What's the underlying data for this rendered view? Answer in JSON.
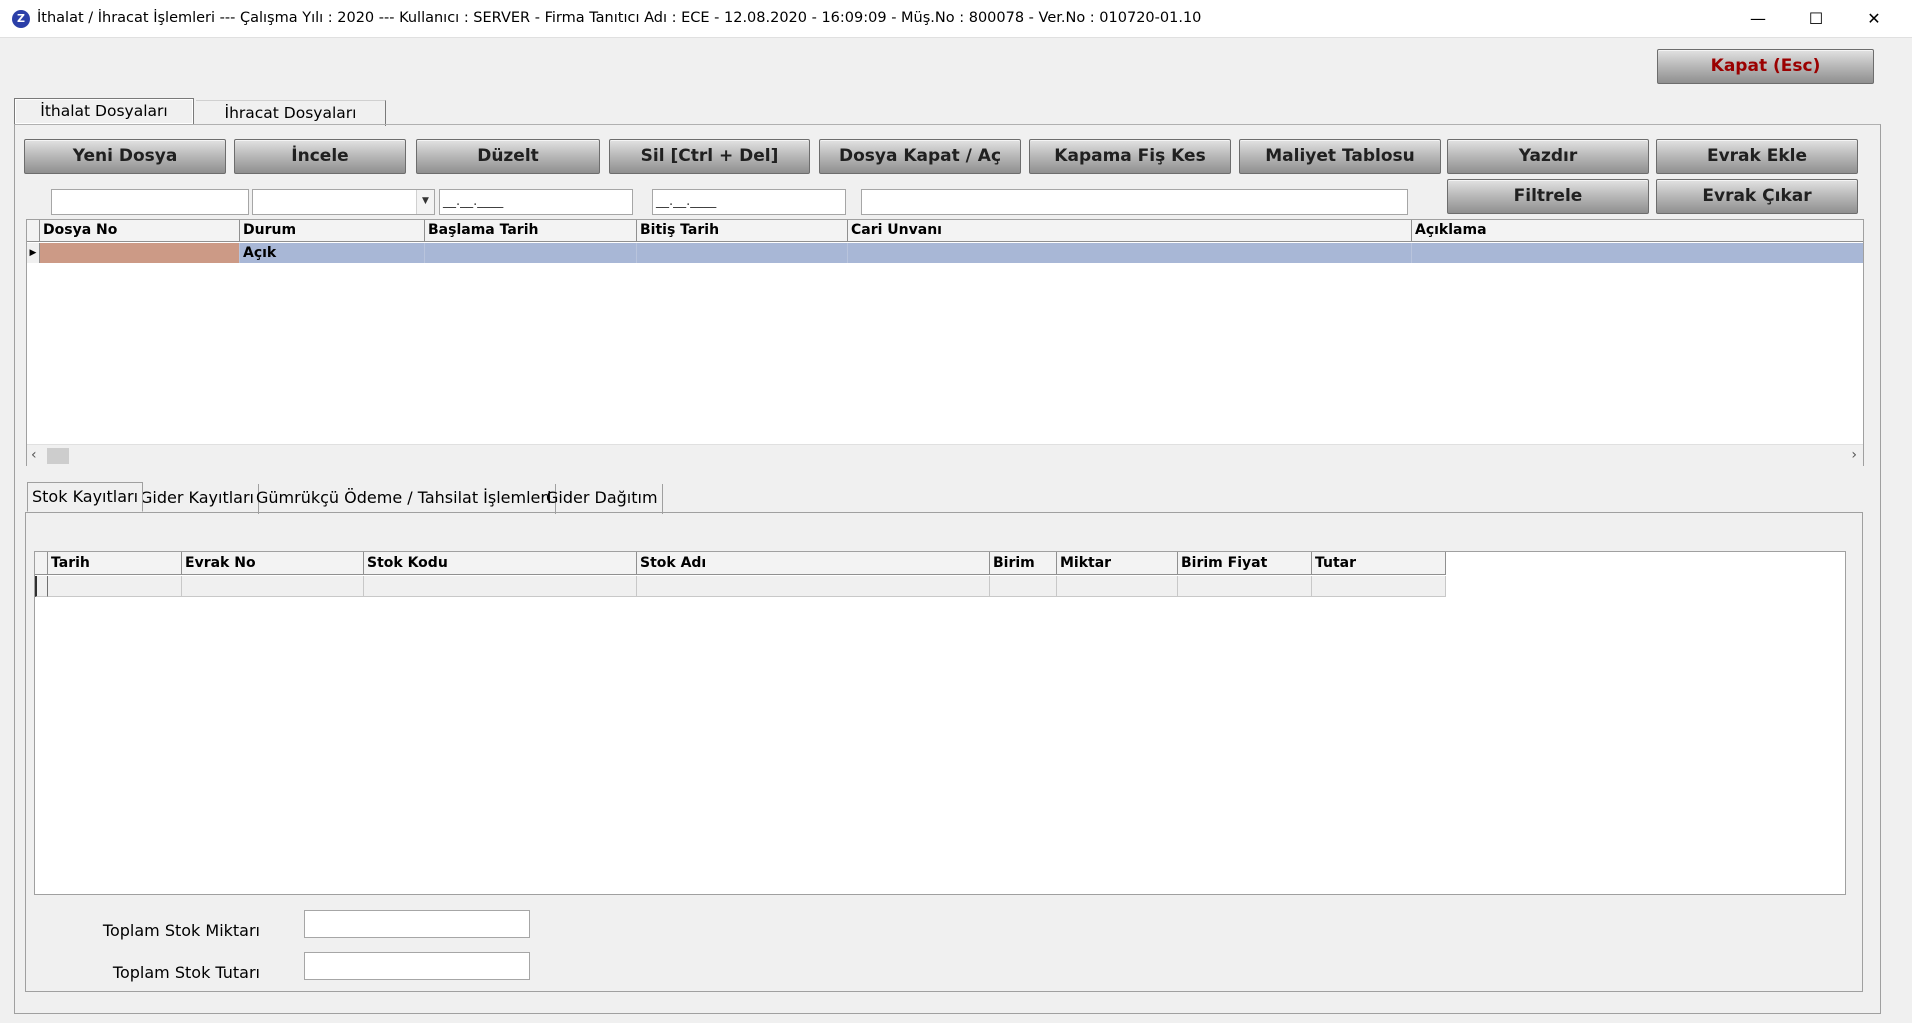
{
  "window": {
    "title": "İthalat / İhracat İşlemleri  ---  Çalışma Yılı : 2020  ---  Kullanıcı : SERVER - Firma Tanıtıcı Adı : ECE - 12.08.2020 - 16:09:09 - Müş.No : 800078 - Ver.No : 010720-01.10",
    "app_icon": "Z",
    "minimize": "—",
    "maximize": "☐",
    "close": "✕"
  },
  "close_button": "Kapat (Esc)",
  "main_tabs": [
    "İthalat Dosyaları",
    "İhracat Dosyaları"
  ],
  "toolbar": {
    "buttons": [
      "Yeni Dosya",
      "İncele",
      "Düzelt",
      "Sil [Ctrl + Del]",
      "Dosya Kapat / Aç",
      "Kapama Fiş Kes",
      "Maliyet Tablosu",
      "Yazdır",
      "Evrak Ekle"
    ],
    "filter": "Filtrele",
    "evrak_cikar": "Evrak Çıkar"
  },
  "filters": {
    "date_start": "__.__.____",
    "date_end": "__.__.____"
  },
  "main_grid": {
    "columns": [
      "Dosya No",
      "Durum",
      "Başlama Tarih",
      "Bitiş Tarih",
      "Cari Unvanı",
      "Açıklama"
    ],
    "rows": [
      {
        "dosya_no": "",
        "durum": "Açık",
        "baslama": "",
        "bitis": "",
        "cari": "",
        "aciklama": ""
      }
    ]
  },
  "sub_tabs": [
    "Stok Kayıtları",
    "Gider Kayıtları",
    "Gümrükçü Ödeme / Tahsilat İşlemleri",
    "Gider Dağıtım"
  ],
  "stock_grid": {
    "columns": [
      "Tarih",
      "Evrak No",
      "Stok Kodu",
      "Stok Adı",
      "Birim",
      "Miktar",
      "Birim Fiyat",
      "Tutar"
    ]
  },
  "totals": {
    "miktar_label": "Toplam Stok Miktarı",
    "miktar_value": "",
    "tutar_label": "Toplam Stok Tutarı",
    "tutar_value": ""
  }
}
